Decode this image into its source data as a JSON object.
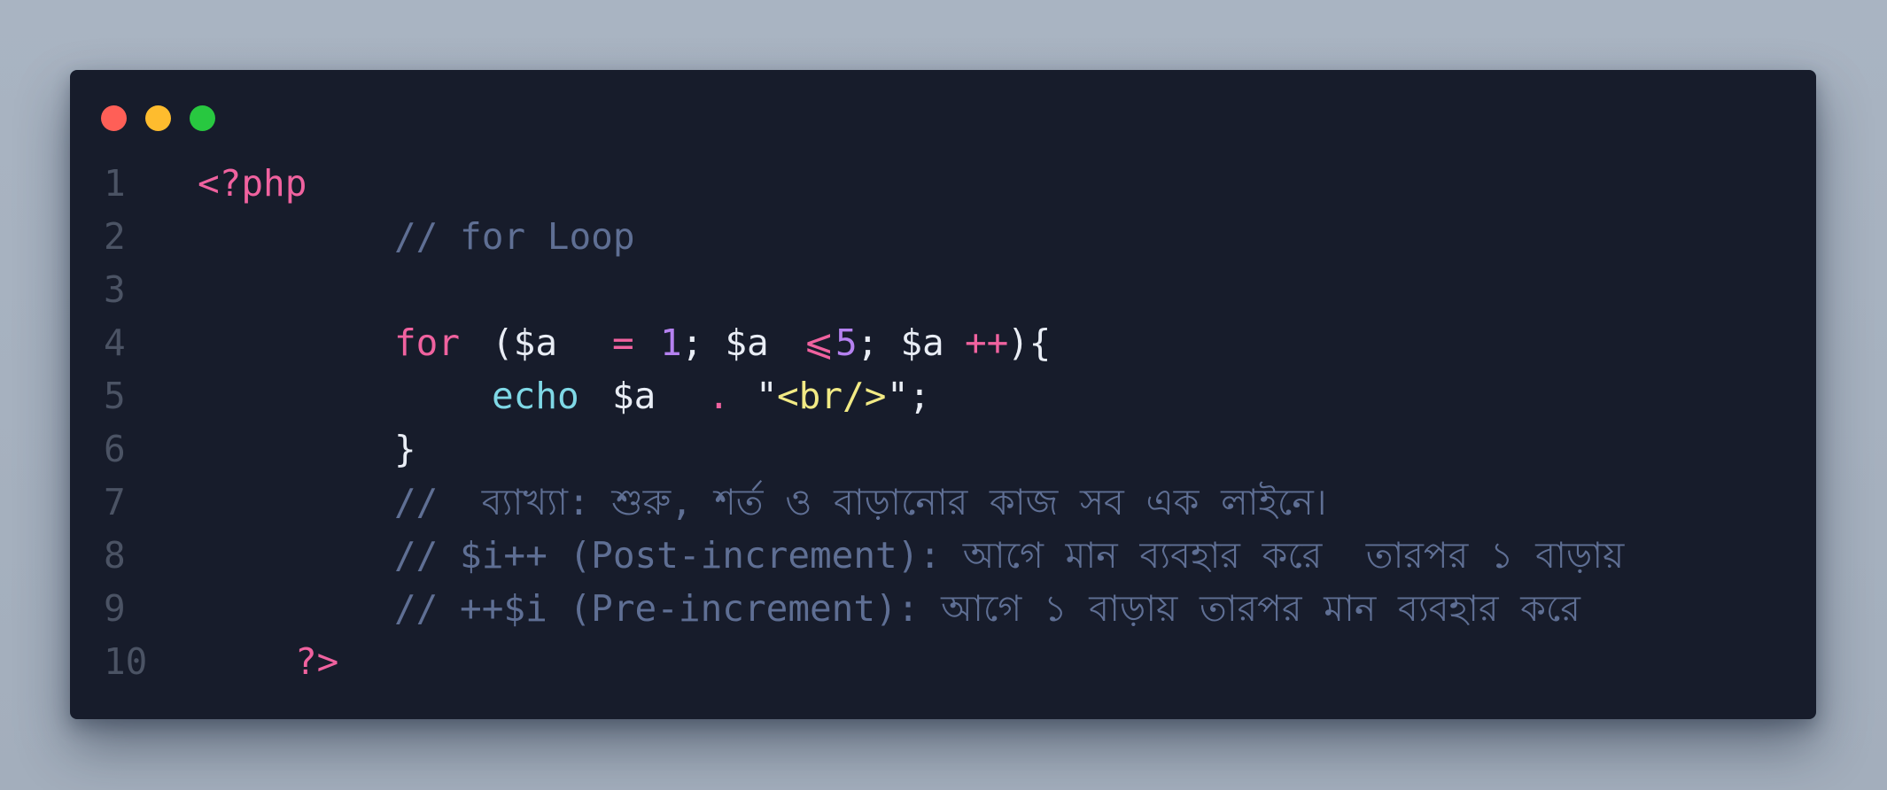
{
  "window": {
    "traffic_lights": {
      "close_color": "#ff5f57",
      "minimize_color": "#febc2e",
      "maximize_color": "#28c840"
    }
  },
  "code": {
    "lines": [
      {
        "number": "1"
      },
      {
        "number": "2"
      },
      {
        "number": "3"
      },
      {
        "number": "4"
      },
      {
        "number": "5"
      },
      {
        "number": "6"
      },
      {
        "number": "7"
      },
      {
        "number": "8"
      },
      {
        "number": "9"
      },
      {
        "number": "10"
      }
    ],
    "tokens": {
      "open_tag": "<?php",
      "comment_for_loop": "// for Loop",
      "kw_for": "for",
      "paren_open_var": "($a",
      "op_assign": "=",
      "num_1": "1",
      "semi_var": "; $a",
      "op_lte": "⩽",
      "num_5": "5",
      "semi_var2": "; $a",
      "op_inc": "++",
      "paren_close_brace": "){",
      "kw_echo": "echo",
      "var_a": "$a",
      "op_concat": ".",
      "quote_open": "\"",
      "str_br": "<br/>",
      "quote_close_semi": "\";",
      "brace_close": "}",
      "comment_explain": "//  ব্যাখ্যা: শুরু, শর্ত ও বাড়ানোর কাজ সব এক লাইনে।",
      "comment_post": "// $i++ (Post-increment): আগে মান ব্যবহার করে  তারপর ১ বাড়ায়",
      "comment_pre": "// ++$i (Pre-increment): আগে ১ বাড়ায় তারপর মান ব্যবহার করে",
      "close_tag": "?>"
    },
    "colors": {
      "background": "#171c2b",
      "keyword": "#f0629f",
      "comment": "#5f6f94",
      "number": "#b581f0",
      "function": "#7fd8e6",
      "string": "#f2ea85",
      "plain": "#e9edf5",
      "line_number": "#4b5364"
    }
  }
}
